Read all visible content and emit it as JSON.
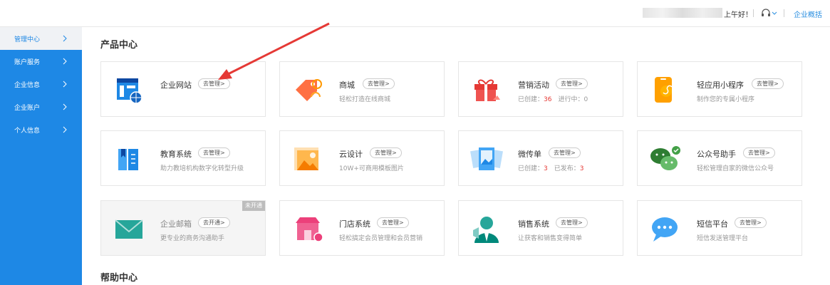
{
  "header": {
    "greeting": "上午好！",
    "overview_label": "企业概括"
  },
  "sidebar": {
    "items": [
      {
        "label": "管理中心"
      },
      {
        "label": "账户服务"
      },
      {
        "label": "企业信息"
      },
      {
        "label": "企业账户"
      },
      {
        "label": "个人信息"
      }
    ]
  },
  "main": {
    "product_section_title": "产品中心",
    "help_section_title": "帮助中心",
    "cards": [
      {
        "name": "企业网站",
        "action": "去管理>",
        "desc": ""
      },
      {
        "name": "商城",
        "action": "去管理>",
        "desc": "轻松打造在线商城"
      },
      {
        "name": "营销活动",
        "action": "去管理>",
        "desc_pre": "已创建：",
        "desc_num1": "36",
        "desc_mid": "　进行中：0"
      },
      {
        "name": "轻应用小程序",
        "action": "去管理>",
        "desc": "制作您的专属小程序"
      },
      {
        "name": "教育系统",
        "action": "去管理>",
        "desc": "助力教培机构数字化转型升级"
      },
      {
        "name": "云设计",
        "action": "去管理>",
        "desc": "10W+可商用模板图片"
      },
      {
        "name": "微传单",
        "action": "去管理>",
        "desc_pre": "已创建：",
        "desc_num1": "3",
        "desc_mid": "　已发布：",
        "desc_num2": "3"
      },
      {
        "name": "公众号助手",
        "action": "去管理>",
        "desc": "轻松管理自家的微信公众号"
      },
      {
        "name": "企业邮箱",
        "action": "去开通>",
        "desc": "更专业的商务沟通助手",
        "badge": "未开通"
      },
      {
        "name": "门店系统",
        "action": "去管理>",
        "desc": "轻松搞定会员管理和会员营销"
      },
      {
        "name": "销售系统",
        "action": "去管理>",
        "desc": "让获客和销售变得简单"
      },
      {
        "name": "短信平台",
        "action": "去管理>",
        "desc": "短信发送管理平台"
      }
    ]
  },
  "icons": {
    "website": "website-icon",
    "mall": "mall-tag-icon",
    "marketing": "gift-icon",
    "miniprogram": "phone-miniprogram-icon",
    "education": "book-icon",
    "design": "image-icon",
    "flyer": "flyer-icon",
    "wechat": "wechat-icon",
    "mail": "mail-icon",
    "store": "store-icon",
    "sales": "salesperson-icon",
    "sms": "chat-bubble-icon"
  },
  "colors": {
    "sidebar_bg": "#1e88e5",
    "sidebar_active": "#2a3341",
    "accent_red": "#e53935",
    "link_blue": "#2b8fe0"
  }
}
